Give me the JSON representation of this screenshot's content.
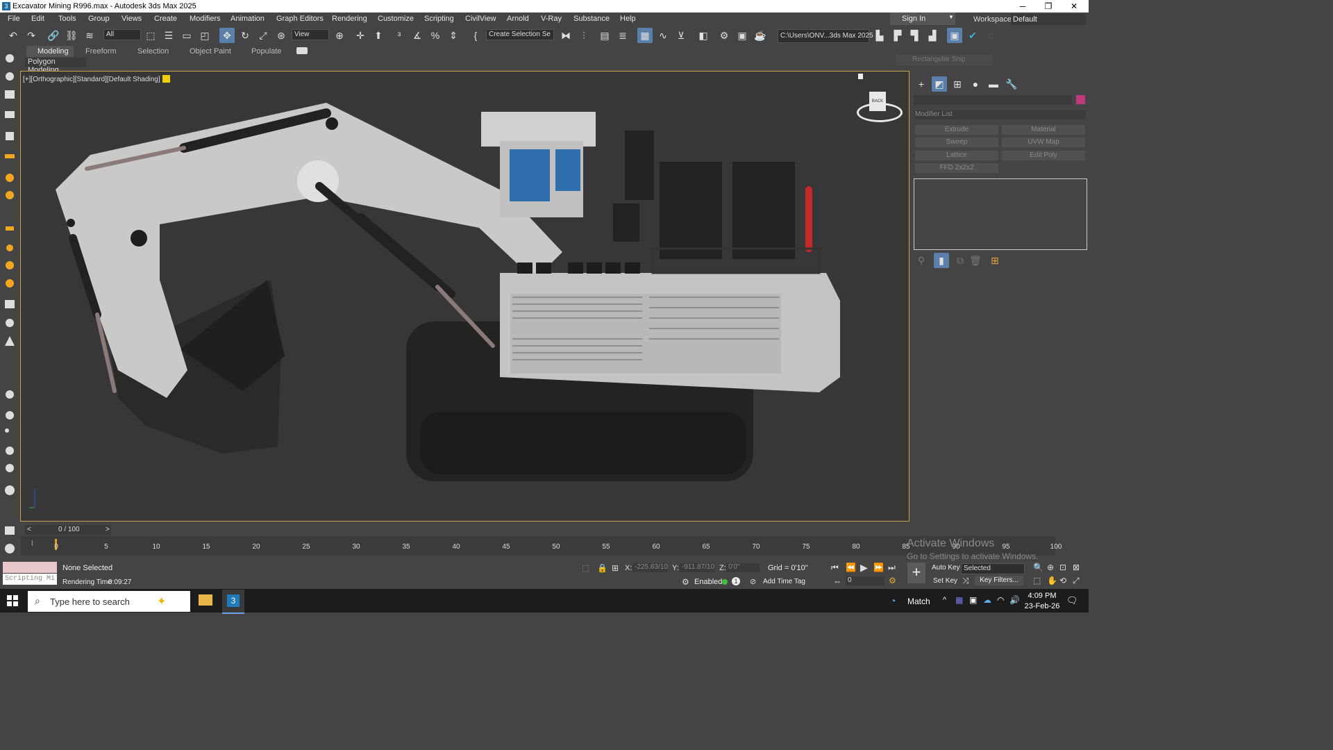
{
  "window": {
    "title": "Excavator Mining R996.max - Autodesk 3ds Max 2025",
    "minimize": "─",
    "maximize": "❐",
    "close": "✕"
  },
  "menu": [
    "File",
    "Edit",
    "Tools",
    "Group",
    "Views",
    "Create",
    "Modifiers",
    "Animation",
    "Graph Editors",
    "Rendering",
    "Customize",
    "Scripting",
    "CivilView",
    "Arnold",
    "V-Ray",
    "Substance",
    "Help"
  ],
  "account": {
    "sign_in": "Sign In",
    "workspaces_label": "Workspaces:",
    "workspace": "Default"
  },
  "toolbar": {
    "selection_filter": "All",
    "ref_coord": "View",
    "named_selection": "Create Selection Se",
    "project_path": "C:\\Users\\ONV...3ds Max 2025"
  },
  "ribbon": {
    "tabs": [
      "Modeling",
      "Freeform",
      "Selection",
      "Object Paint",
      "Populate"
    ],
    "active_panel": "Polygon Modeling"
  },
  "viewport": {
    "label": "[+][Orthographic][Standard][Default Shading]",
    "viewcube_face": "BACK"
  },
  "command_panel": {
    "modifier_list": "Modifier List",
    "modifier_buttons": [
      "Extrude",
      "Material",
      "Sweep",
      "UVW Map",
      "Lattice",
      "Edit Poly",
      "FFD 2x2x2"
    ],
    "floating_tip": "Rectangular Snip"
  },
  "timeline": {
    "frame_display": "0 / 100",
    "prev": "<",
    "next": ">",
    "ticks": [
      "0",
      "5",
      "10",
      "15",
      "20",
      "25",
      "30",
      "35",
      "40",
      "45",
      "50",
      "55",
      "60",
      "65",
      "70",
      "75",
      "80",
      "85",
      "90",
      "95",
      "100"
    ]
  },
  "status": {
    "maxscript": "Scripting Mi",
    "selection": "None Selected",
    "render_time_label": "Rendering Time",
    "render_time": "0:09:27",
    "x_label": "X:",
    "x_value": "-225.83/10",
    "y_label": "Y:",
    "y_value": "-911.87/10",
    "z_label": "Z:",
    "z_value": "0'0\"",
    "grid": "Grid = 0'10\"",
    "enabled_label": "Enabled:",
    "add_time_tag": "Add Time Tag",
    "auto_key": "Auto Key",
    "set_key": "Set Key",
    "key_mode": "Selected",
    "key_filters": "Key Filters...",
    "current_frame": "0"
  },
  "activation": {
    "title": "Activate Windows",
    "subtitle": "Go to Settings to activate Windows."
  },
  "taskbar": {
    "search_placeholder": "Type here to search",
    "weather": "Match",
    "time": "4:09 PM",
    "date": "23-Feb-26"
  },
  "colors": {
    "accent_blue": "#5a7fa8",
    "viewport_border": "#c8a24a",
    "object_color": "#c0397b",
    "shading_swatch": "#f2d000"
  }
}
